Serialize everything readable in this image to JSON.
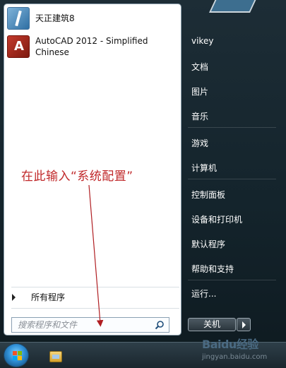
{
  "programs": [
    {
      "label": "天正建筑8",
      "icon": "tarch-icon"
    },
    {
      "label": "AutoCAD 2012 - Simplified Chinese",
      "icon": "autocad-icon"
    }
  ],
  "annotation": "在此输入“系统配置”",
  "all_programs_label": "所有程序",
  "search": {
    "placeholder": "搜索程序和文件"
  },
  "right_menu": {
    "user": "vikey",
    "documents": "文档",
    "pictures": "图片",
    "music": "音乐",
    "games": "游戏",
    "computer": "计算机",
    "control_panel": "控制面板",
    "devices": "设备和打印机",
    "default_programs": "默认程序",
    "help": "帮助和支持",
    "run": "运行..."
  },
  "shutdown_label": "关机",
  "watermark": {
    "logo": "Baidu经验",
    "url": "jingyan.baidu.com"
  },
  "colors": {
    "annotation": "#c0282a",
    "panel": "#ffffff",
    "right_bg": "#1d2d36"
  }
}
